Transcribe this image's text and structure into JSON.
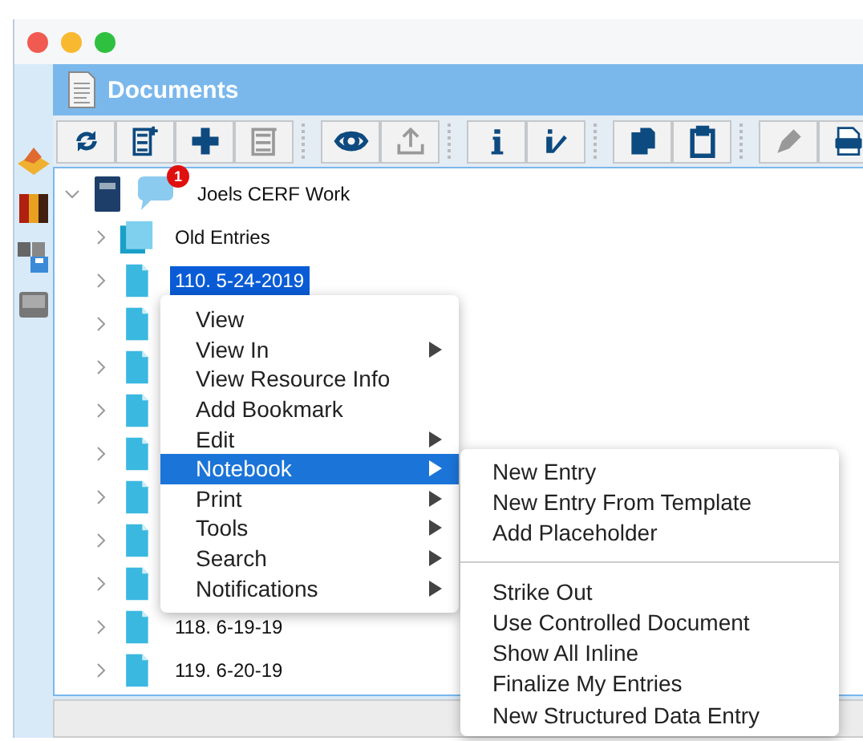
{
  "panel": {
    "title": "Documents"
  },
  "toolbar": [
    [
      {
        "disabled": false
      },
      {
        "disabled": false
      },
      {
        "disabled": false
      },
      {
        "disabled": true
      }
    ],
    [
      {
        "disabled": false
      },
      {
        "disabled": true
      }
    ],
    [
      {
        "disabled": false
      },
      {
        "disabled": false
      }
    ],
    [
      {
        "disabled": false
      },
      {
        "disabled": false
      }
    ],
    [
      {
        "disabled": true
      },
      {
        "disabled": false
      }
    ]
  ],
  "tree": {
    "label": "Joels CERF Work",
    "badge": "1",
    "expanded": true,
    "children": [
      {
        "label": "Old Entries",
        "kind": "folder",
        "selected": false
      },
      {
        "label": "110. 5-24-2019",
        "kind": "page",
        "selected": true
      },
      {
        "kind": "page",
        "selected": false
      },
      {
        "kind": "page",
        "selected": false
      },
      {
        "kind": "page",
        "selected": false
      },
      {
        "kind": "page",
        "selected": false
      },
      {
        "kind": "page",
        "selected": false
      },
      {
        "kind": "page",
        "selected": false
      },
      {
        "kind": "page",
        "selected": false
      },
      {
        "label": "118. 6-19-19",
        "kind": "page",
        "selected": false
      },
      {
        "label": "119. 6-20-19",
        "kind": "page",
        "selected": false
      }
    ]
  },
  "context_menu": [
    {
      "label": "View",
      "submenu": false,
      "selected": false
    },
    {
      "label": "View In",
      "submenu": true,
      "selected": false
    },
    {
      "label": "View Resource Info",
      "submenu": false,
      "selected": false
    },
    {
      "label": "Add Bookmark",
      "submenu": false,
      "selected": false
    },
    {
      "label": "Edit",
      "submenu": true,
      "selected": false
    },
    {
      "label": "Notebook",
      "submenu": true,
      "selected": true
    },
    {
      "label": "Print",
      "submenu": true,
      "selected": false
    },
    {
      "label": "Tools",
      "submenu": true,
      "selected": false
    },
    {
      "label": "Search",
      "submenu": true,
      "selected": false
    },
    {
      "label": "Notifications",
      "submenu": true,
      "selected": false
    }
  ],
  "submenu": [
    [
      {
        "label": "New Entry"
      },
      {
        "label": "New Entry From Template"
      },
      {
        "label": "Add Placeholder"
      }
    ],
    [
      {
        "label": "Strike Out"
      },
      {
        "label": "Use Controlled Document"
      },
      {
        "label": "Show All Inline"
      },
      {
        "label": "Finalize My Entries"
      },
      {
        "label": "New Structured Data Entry"
      }
    ]
  ]
}
